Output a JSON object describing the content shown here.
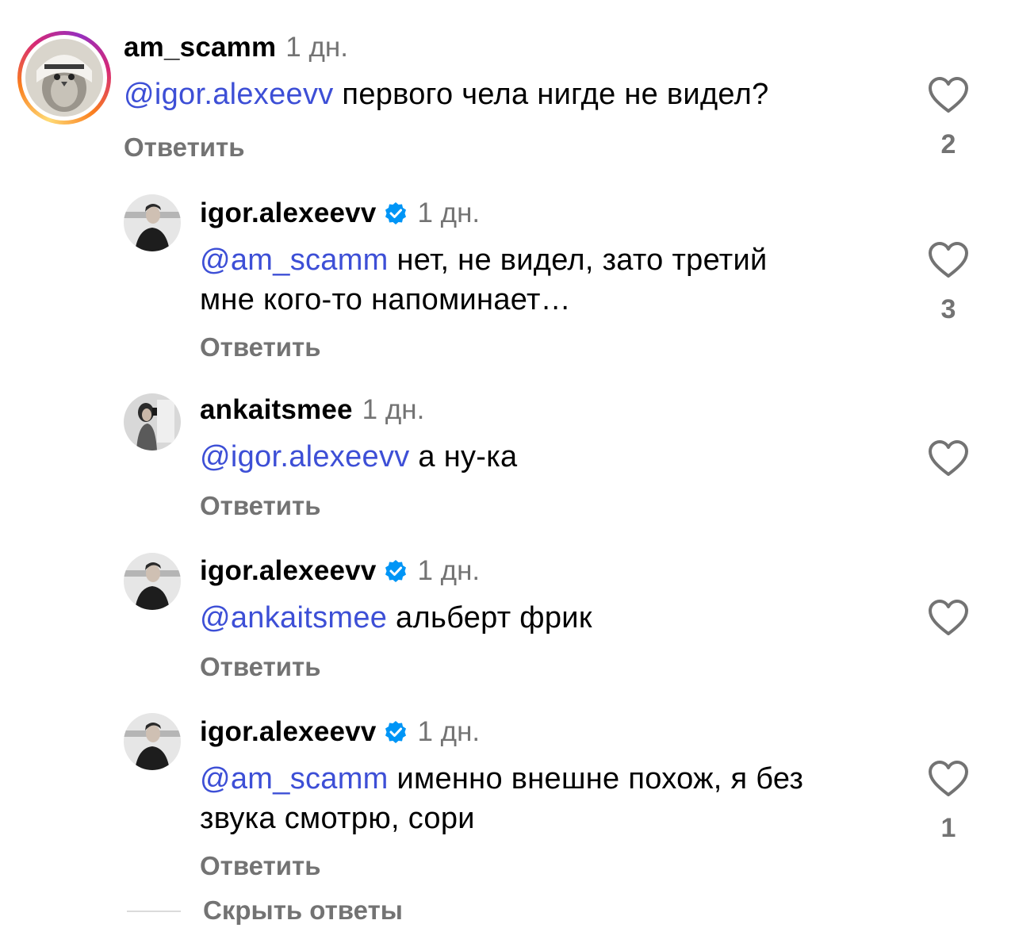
{
  "colors": {
    "mention": "#3d4fd6",
    "secondary_text": "#737373",
    "verified_badge": "#0095f6"
  },
  "comments": [
    {
      "username": "am_scamm",
      "time": "1 дн.",
      "verified": false,
      "mention": "@igor.alexeevv",
      "text_line1": " первого чела нигде не видел?",
      "text_line2": "",
      "reply_label": "Ответить",
      "likes": "2",
      "avatar_icon": "penguin-avatar"
    },
    {
      "username": "igor.alexeevv",
      "time": "1 дн.",
      "verified": true,
      "mention": "@am_scamm",
      "text_line1": " нет, не видел, зато третий",
      "text_line2": "мне кого-то напоминает…",
      "reply_label": "Ответить",
      "likes": "3",
      "avatar_icon": "person-photo-avatar"
    },
    {
      "username": "ankaitsmee",
      "time": "1 дн.",
      "verified": false,
      "mention": "@igor.alexeevv",
      "text_line1": " а ну-ка",
      "text_line2": "",
      "reply_label": "Ответить",
      "likes": "",
      "avatar_icon": "mirror-selfie-avatar"
    },
    {
      "username": "igor.alexeevv",
      "time": "1 дн.",
      "verified": true,
      "mention": "@ankaitsmee",
      "text_line1": " альберт фрик",
      "text_line2": "",
      "reply_label": "Ответить",
      "likes": "",
      "avatar_icon": "person-photo-avatar"
    },
    {
      "username": "igor.alexeevv",
      "time": "1 дн.",
      "verified": true,
      "mention": "@am_scamm",
      "text_line1": " именно внешне похож, я без",
      "text_line2": "звука смотрю, сори",
      "reply_label": "Ответить",
      "likes": "1",
      "avatar_icon": "person-photo-avatar"
    }
  ],
  "hide_replies_label": "Скрыть ответы"
}
